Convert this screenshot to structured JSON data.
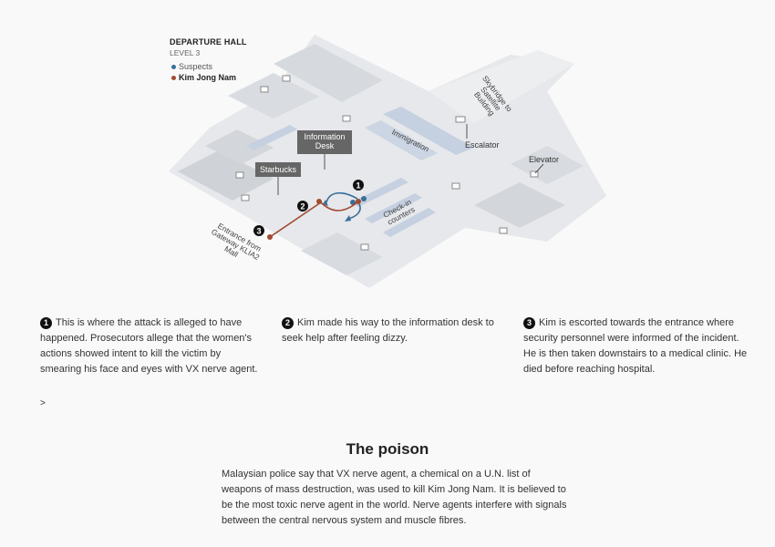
{
  "map": {
    "title": "DEPARTURE HALL",
    "level": "LEVEL 3",
    "legend": [
      {
        "label": "Suspects",
        "color": "#3a6f9a"
      },
      {
        "label": "Kim Jong Nam",
        "color": "#a24b33"
      }
    ],
    "labels": {
      "information_desk": "Information Desk",
      "starbucks": "Starbucks",
      "immigration": "Immigration",
      "skybridge": "Skybridge to Satellite Building",
      "escalator": "Escalator",
      "elevator": "Elevator",
      "checkin": "Check-in counters",
      "entrance": "Entrance from Gateway KLIA2 Mall"
    },
    "markers": [
      "1",
      "2",
      "3"
    ]
  },
  "captions": [
    {
      "number": "1",
      "text": "This is where the attack is alleged to have happened. Prosecutors allege that the women's actions showed intent to kill the victim by smearing his face and eyes with VX nerve agent."
    },
    {
      "number": "2",
      "text": "Kim made his way to the information desk to seek help after feeling dizzy."
    },
    {
      "number": "3",
      "text": "Kim is escorted towards the entrance where security personnel were informed of the incident. He is then taken downstairs to a medical clinic. He died before reaching hospital."
    }
  ],
  "more_link": ">",
  "section": {
    "title": "The poison",
    "body": "Malaysian police say that VX nerve agent, a chemical on a U.N. list of weapons of mass destruction, was used to kill Kim Jong Nam. It is believed to be the most toxic nerve agent in the world. Nerve agents interfere with signals between the central nervous system and muscle fibres."
  },
  "colors": {
    "suspects": "#3a6f9a",
    "victim": "#a24b33",
    "floor": "#e4e6e9",
    "blocks": "#cfd2d6",
    "counters": "#c5d0e0",
    "label_box": "#666666"
  }
}
